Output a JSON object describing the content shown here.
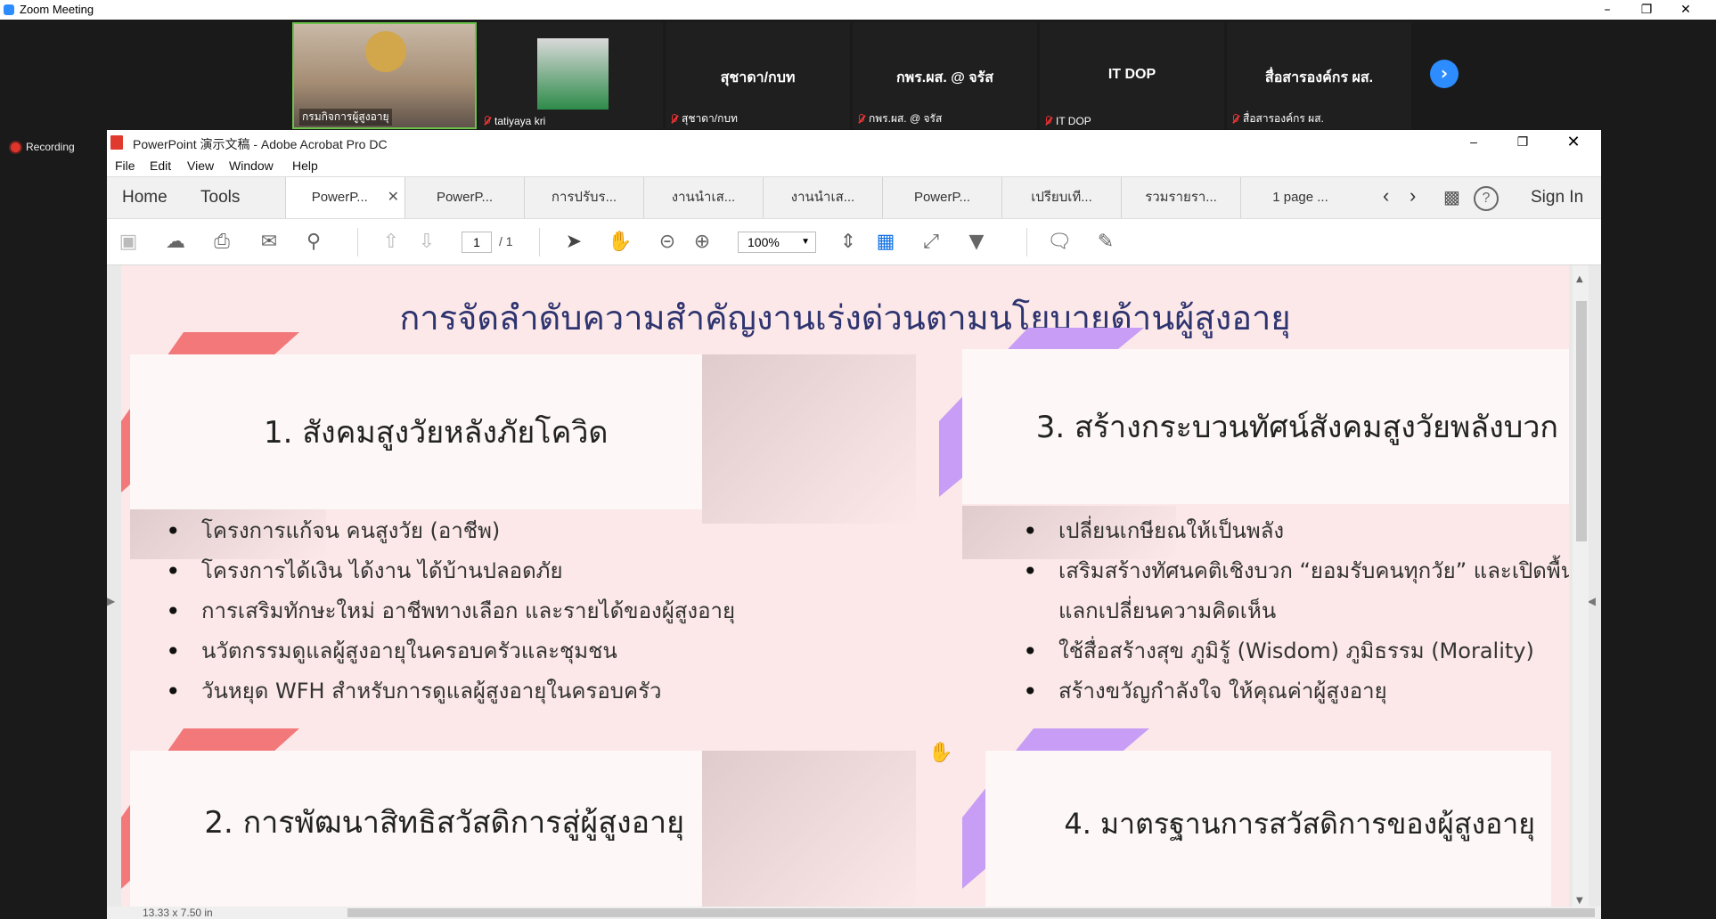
{
  "zoom": {
    "title": "Zoom Meeting",
    "recording": "Recording",
    "participants": [
      {
        "label": "กรมกิจการผู้สูงอายุ",
        "name": ""
      },
      {
        "label": "tatiyaya kri",
        "name": ""
      },
      {
        "label": "สุชาดา/กบท",
        "name": "สุชาดา/กบท"
      },
      {
        "label": "กพร.ผส. @ จรัส",
        "name": "กพร.ผส. @ จรัส"
      },
      {
        "label": "IT DOP",
        "name": "IT DOP"
      },
      {
        "label": "สื่อสารองค์กร ผส.",
        "name": "สื่อสารองค์กร ผส."
      }
    ]
  },
  "acrobat": {
    "title": "PowerPoint 演示文稿 - Adobe Acrobat Pro DC",
    "menu": [
      "File",
      "Edit",
      "View",
      "Window",
      "Help"
    ],
    "nav": {
      "home": "Home",
      "tools": "Tools",
      "signin": "Sign In"
    },
    "tabs": [
      "PowerP...",
      "PowerP...",
      "การปรับร...",
      "งานนำเส...",
      "งานนำเส...",
      "PowerP...",
      "เปรียบเที...",
      "รวมรายรา...",
      "1 page ..."
    ],
    "page_current": "1",
    "page_total": "/ 1",
    "zoom_level": "100%",
    "page_size": "13.33 x 7.50 in"
  },
  "slide": {
    "title": "การจัดลำดับความสำคัญงานเร่งด่วนตามนโยบายด้านผู้สูงอายุ",
    "s1": {
      "heading": "1. สังคมสูงวัยหลังภัยโควิด",
      "bullets": [
        "โครงการแก้จน คนสูงวัย (อาชีพ)",
        "โครงการได้เงิน ได้งาน ได้บ้านปลอดภัย",
        "การเสริมทักษะใหม่ อาชีพทางเลือก และรายได้ของผู้สูงอายุ",
        "นวัตกรรมดูแลผู้สูงอายุในครอบครัวและชุมชน",
        "วันหยุด WFH สำหรับการดูแลผู้สูงอายุในครอบครัว"
      ]
    },
    "s2": {
      "heading": "2. การพัฒนาสิทธิสวัสดิการสู่ผู้สูงอายุ"
    },
    "s3": {
      "heading": "3. สร้างกระบวนทัศน์สังคมสูงวัยพลังบวก",
      "bullets": [
        "เปลี่ยนเกษียณให้เป็นพลัง",
        "เสริมสร้างทัศนคติเชิงบวก “ยอมรับคนทุกวัย” และเปิดพื้นที่",
        "แลกเปลี่ยนความคิดเห็น",
        "ใช้สื่อสร้างสุข ภูมิรู้ (Wisdom) ภูมิธรรม (Morality)",
        "สร้างขวัญกำลังใจ ให้คุณค่าผู้สูงอายุ"
      ]
    },
    "s4": {
      "heading": "4. มาตรฐานการสวัสดิการของผู้สูงอายุ"
    }
  },
  "colors": {
    "coral": "#f2787a",
    "lavender": "#c79df5",
    "title_navy": "#2e3470",
    "zoom_blue": "#2d8cff",
    "acrobat_blue": "#1473e6"
  }
}
